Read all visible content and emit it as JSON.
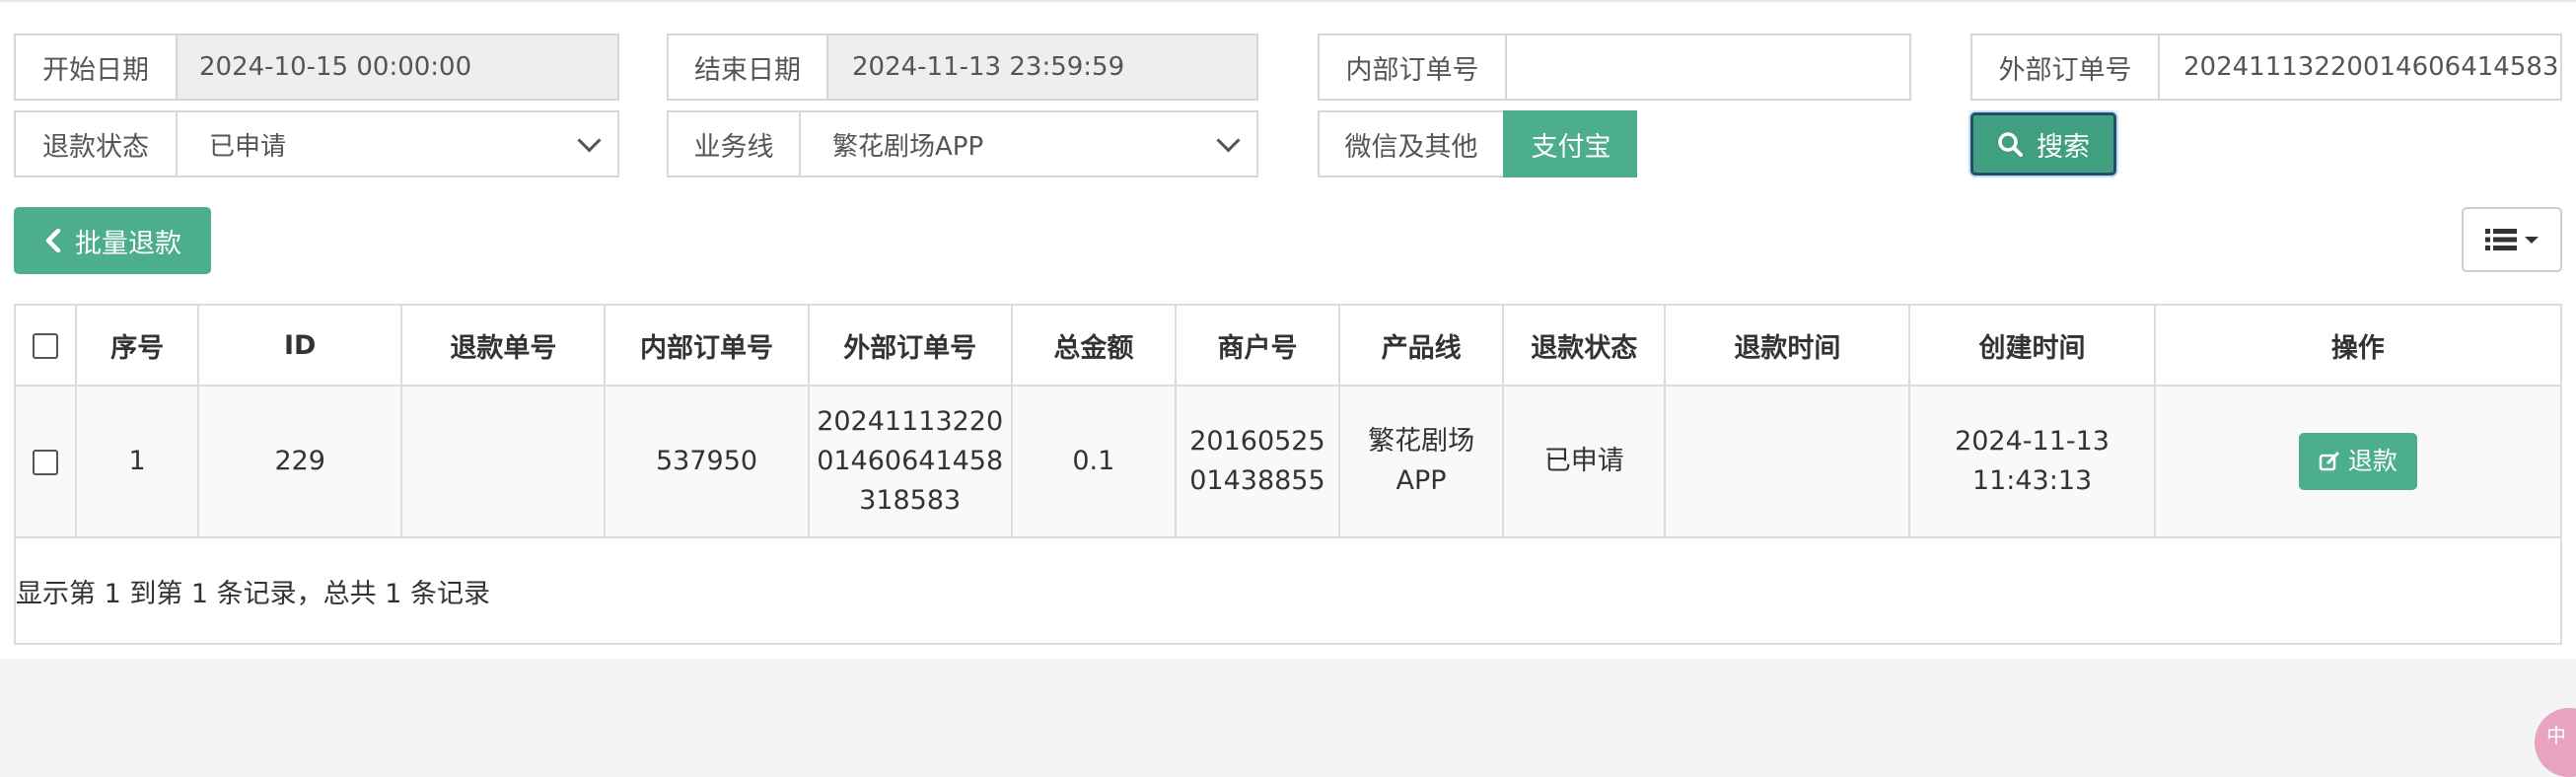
{
  "filters": {
    "start_date": {
      "label": "开始日期",
      "value": "2024-10-15 00:00:00"
    },
    "end_date": {
      "label": "结束日期",
      "value": "2024-11-13 23:59:59"
    },
    "internal_order": {
      "label": "内部订单号",
      "value": ""
    },
    "external_order": {
      "label": "外部订单号",
      "value": "20241113220014606414583"
    },
    "refund_status": {
      "label": "退款状态",
      "value": "已申请"
    },
    "business_line": {
      "label": "业务线",
      "value": "繁花剧场APP"
    },
    "pay_other": "微信及其他",
    "pay_alipay": "支付宝",
    "search_label": "搜索"
  },
  "toolbar": {
    "batch_refund": "批量退款"
  },
  "table": {
    "headers": [
      "序号",
      "ID",
      "退款单号",
      "内部订单号",
      "外部订单号",
      "总金额",
      "商户号",
      "产品线",
      "退款状态",
      "退款时间",
      "创建时间",
      "操作"
    ],
    "rows": [
      {
        "seq": "1",
        "id": "229",
        "refund_no": "",
        "internal_order": "537950",
        "external_order_l1": "20241113220",
        "external_order_l2": "01460641458",
        "external_order_l3": "318583",
        "amount": "0.1",
        "merchant_l1": "20160525",
        "merchant_l2": "01438855",
        "product_l1": "繁花剧场",
        "product_l2": "APP",
        "status": "已申请",
        "refund_time": "",
        "created_date": "2024-11-13",
        "created_time": "11:43:13",
        "action": "退款"
      }
    ]
  },
  "pagination_text": "显示第 1 到第 1 条记录，总共 1 条记录",
  "corner_badge": "中"
}
